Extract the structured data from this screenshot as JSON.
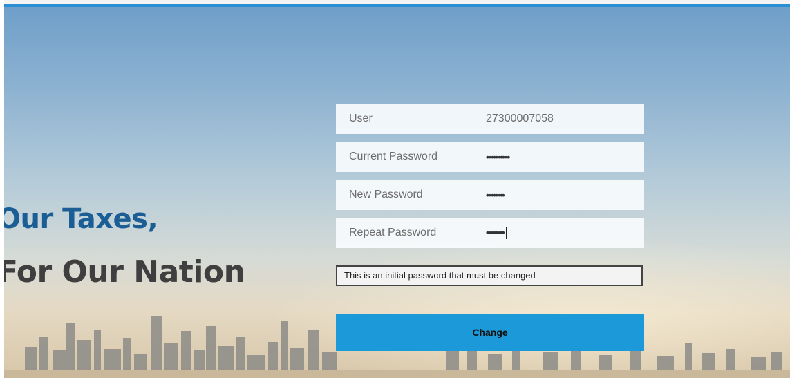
{
  "slogan": {
    "line1": "Our Taxes,",
    "line2": "For Our Nation"
  },
  "form": {
    "user_label": "User",
    "user_value": "27300007058",
    "current_password_label": "Current Password",
    "current_password_mask": "•••••••••••••",
    "new_password_label": "New Password",
    "new_password_mask": "••••••••••",
    "repeat_password_label": "Repeat Password",
    "repeat_password_mask": "••••••••••",
    "notice": "This is an initial password that must be changed",
    "change_button": "Change"
  },
  "colors": {
    "accent": "#1c99d8",
    "slogan_blue": "#1a5e95",
    "slogan_gray": "#3f3f3f"
  }
}
